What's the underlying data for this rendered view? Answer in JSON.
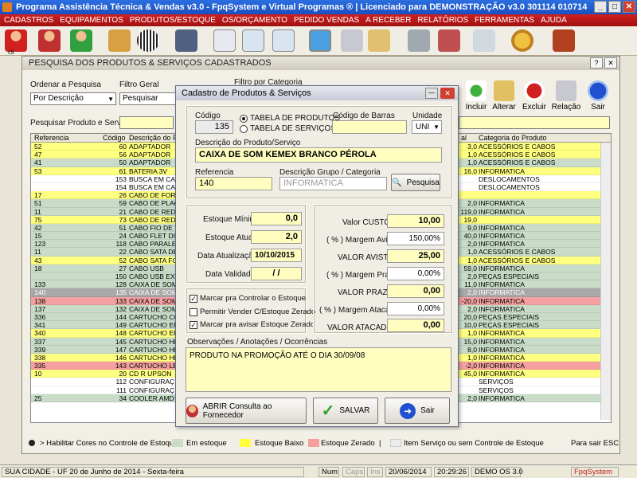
{
  "app": {
    "title": "Programa Assistência Técnica & Vendas v3.0 - FpqSystem e Virtual Programas ® | Licenciado para  DEMONSTRAÇÃO v3.0 301114 010714"
  },
  "menu": [
    "CADASTROS",
    "EQUIPAMENTOS",
    "PRODUTOS/ESTOQUE",
    "OS/ORÇAMENTO",
    "PEDIDO VENDAS",
    "A RECEBER",
    "RELATÓRIOS",
    "FERRAMENTAS",
    "AJUDA"
  ],
  "toolbar": {
    "first_label": "cli"
  },
  "main": {
    "title": "PESQUISA DOS PRODUTOS & SERVIÇOS CADASTRADOS",
    "order_label": "Ordenar a Pesquisa",
    "order_value": "Por Descrição",
    "filter_label": "Filtro Geral",
    "filter_value": "Pesquisar TODOS",
    "category_label": "Filtro por Categoria",
    "search_label": "Pesquisar Produto e Serviço",
    "buttons": {
      "incluir": "Incluir",
      "alterar": "Alterar",
      "excluir": "Excluir",
      "relacao": "Relação",
      "sair": "Sair"
    },
    "columns": [
      "Referencia",
      "Código",
      "Descrição do Pr",
      "al",
      "Categoria do Produto"
    ],
    "rows": [
      {
        "ref": "52",
        "cod": "60",
        "desc": "ADAPTADOR",
        "qty": "3,0",
        "cat": "ACESSÓRIOS E CABOS",
        "c": "y"
      },
      {
        "ref": "47",
        "cod": "56",
        "desc": "ADAPTADOR",
        "qty": "1,0",
        "cat": "ACESSÓRIOS E CABOS",
        "c": "y"
      },
      {
        "ref": "41",
        "cod": "50",
        "desc": "ADAPTADOR",
        "qty": "1,0",
        "cat": "ACESSÓRIOS E CABOS",
        "c": "g"
      },
      {
        "ref": "53",
        "cod": "61",
        "desc": "BATERIA 3V",
        "qty": "16,0",
        "cat": "INFORMATICA",
        "c": "y"
      },
      {
        "ref": "",
        "cod": "153",
        "desc": "BUSCA EM CAS",
        "qty": "",
        "cat": "DESLOCAMENTOS",
        "c": "w"
      },
      {
        "ref": "",
        "cod": "154",
        "desc": "BUSCA EM CAS",
        "qty": "",
        "cat": "DESLOCAMENTOS",
        "c": "w"
      },
      {
        "ref": "17",
        "cod": "26",
        "desc": "CABO DE FOR",
        "qty": "",
        "cat": "",
        "c": "y"
      },
      {
        "ref": "51",
        "cod": "59",
        "desc": "CABO DE PLAC",
        "qty": "2,0",
        "cat": "INFORMATICA",
        "c": "g"
      },
      {
        "ref": "11",
        "cod": "21",
        "desc": "CABO DE RED",
        "qty": "119,0",
        "cat": "INFORMATICA",
        "c": "g"
      },
      {
        "ref": "75",
        "cod": "73",
        "desc": "CABO DE RED",
        "qty": "19,0",
        "cat": "",
        "c": "y"
      },
      {
        "ref": "42",
        "cod": "51",
        "desc": "CABO FIO DE T",
        "qty": "9,0",
        "cat": "INFORMATICA",
        "c": "g"
      },
      {
        "ref": "15",
        "cod": "24",
        "desc": "CABO FLET DIS",
        "qty": "40,0",
        "cat": "INFORMATICA",
        "c": "g"
      },
      {
        "ref": "123",
        "cod": "118",
        "desc": "CABO PARALE",
        "qty": "2,0",
        "cat": "INFORMATICA",
        "c": "g"
      },
      {
        "ref": "11",
        "cod": "22",
        "desc": "CABO SATA DE",
        "qty": "1,0",
        "cat": "ACESSÓRIOS E CABOS",
        "c": "g"
      },
      {
        "ref": "43",
        "cod": "52",
        "desc": "CABO SATA FO",
        "qty": "1,0",
        "cat": "ACESSÓRIOS E CABOS",
        "c": "y"
      },
      {
        "ref": "18",
        "cod": "27",
        "desc": "CABO USB",
        "qty": "59,0",
        "cat": "INFORMATICA",
        "c": "g"
      },
      {
        "ref": "",
        "cod": "150",
        "desc": "CABO USB EXT",
        "qty": "2,0",
        "cat": "PEÇAS ESPECIAIS",
        "c": "g"
      },
      {
        "ref": "133",
        "cod": "128",
        "desc": "CAIXA DE SOM",
        "qty": "11,0",
        "cat": "INFORMATICA",
        "c": "g"
      },
      {
        "ref": "140",
        "cod": "135",
        "desc": "CAIXA DE SOM",
        "qty": "2,0",
        "cat": "INFORMATICA",
        "c": "sel"
      },
      {
        "ref": "138",
        "cod": "133",
        "desc": "CAIXA DE SOM",
        "qty": "-20,0",
        "cat": "INFORMATICA",
        "c": "r"
      },
      {
        "ref": "137",
        "cod": "132",
        "desc": "CAIXA DE SOM",
        "qty": "2,0",
        "cat": "INFORMATICA",
        "c": "g"
      },
      {
        "ref": "336",
        "cod": "144",
        "desc": "CARTUCHO CC",
        "qty": "20,0",
        "cat": "PEÇAS ESPECIAIS",
        "c": "g"
      },
      {
        "ref": "341",
        "cod": "149",
        "desc": "CARTUCHO EP",
        "qty": "10,0",
        "cat": "PEÇAS ESPECIAIS",
        "c": "g"
      },
      {
        "ref": "340",
        "cod": "148",
        "desc": "CARTUCHO EP",
        "qty": "1,0",
        "cat": "INFORMATICA",
        "c": "y"
      },
      {
        "ref": "337",
        "cod": "145",
        "desc": "CARTUCHO HP",
        "qty": "15,0",
        "cat": "INFORMATICA",
        "c": "g"
      },
      {
        "ref": "339",
        "cod": "147",
        "desc": "CARTUCHO HP",
        "qty": "8,0",
        "cat": "INFORMATICA",
        "c": "g"
      },
      {
        "ref": "338",
        "cod": "146",
        "desc": "CARTUCHO HP",
        "qty": "1,0",
        "cat": "INFORMATICA",
        "c": "y"
      },
      {
        "ref": "335",
        "cod": "143",
        "desc": "CARTUCHO LE",
        "qty": "-2,0",
        "cat": "INFORMATICA",
        "c": "r"
      },
      {
        "ref": "10",
        "cod": "20",
        "desc": "CD R UPSON",
        "qty": "45,0",
        "cat": "INFORMATICA",
        "c": "y"
      },
      {
        "ref": "",
        "cod": "112",
        "desc": "CONFIGURAÇ",
        "qty": "",
        "cat": "SERVIÇOS",
        "c": "w"
      },
      {
        "ref": "",
        "cod": "111",
        "desc": "CONFIGURAÇ",
        "qty": "",
        "cat": "SERVIÇOS",
        "c": "w"
      },
      {
        "ref": "25",
        "cod": "34",
        "desc": "COOLER AMD",
        "qty": "2,0",
        "cat": "INFORMATICA",
        "c": "g"
      }
    ]
  },
  "colors": {
    "y": "#ffff80",
    "g": "#c8dcc8",
    "w": "#ffffff",
    "r": "#f4a0a0",
    "sel": "#a8a8a8"
  },
  "legend": {
    "enable": "> Habilitar Cores no Controle de Estoque",
    "stock": "Em estoque",
    "low": "Estoque Baixo",
    "zero": "Estoque Zerado",
    "sep": "|",
    "service": "Item Serviço ou sem Controle de Estoque",
    "esc": "Para sair ESC"
  },
  "modal": {
    "title": "Cadastro de Produtos & Serviços",
    "codigo_label": "Código",
    "codigo": "135",
    "radio_products": "TABELA DE PRODUTOS",
    "radio_services": "TABELA DE SERVIÇOS",
    "barcode_label": "Código de Barras",
    "barcode": "",
    "unit_label": "Unidade",
    "unit": "UNI",
    "desc_label": "Descrição do Produto/Serviço",
    "desc": "CAIXA DE SOM  KEMEX  BRANCO  PÉROLA",
    "ref_label": "Referencia",
    "ref": "140",
    "group_label": "Descrição Grupo / Categoria",
    "group": "INFORMATICA",
    "search_btn": "Pesquisa",
    "est_min_label": "Estoque Mínimo",
    "est_min": "0,0",
    "est_atual_label": "Estoque Atual",
    "est_atual": "2,0",
    "data_atual_label": "Data Atualização",
    "data_atual": "10/10/2015",
    "data_val_label": "Data Validade",
    "data_val": " /  /",
    "chk1": "Marcar pra Controlar o Estoque",
    "chk2": "Permitir Vender C/Estoque Zerado",
    "chk3": "Marcar pra avisar Estoque Zerado",
    "custo_label": "Valor CUSTO",
    "custo": "10,00",
    "mav_label": "( % ) Margem Avista",
    "mav": "150,00%",
    "vav_label": "VALOR AVISTA",
    "vav": "25,00",
    "mpr_label": "( % ) Margem Prazo",
    "mpr": "0,00%",
    "vpr_label": "VALOR PRAZO",
    "vpr": "0,00",
    "mat_label": "( % ) Margem Atacado",
    "mat": "0,00%",
    "vat_label": "VALOR ATACADO",
    "vat": "0,00",
    "obs_label": "Observações / Anotações / Ocorrências",
    "obs": "PRODUTO NA PROMOÇÃO ATÉ O DIA 30/09/08",
    "btn_consulta": "ABRIR Consulta ao Fornecedor",
    "btn_salvar": "SALVAR",
    "btn_sair": "Sair"
  },
  "status": {
    "city": "SUA CIDADE - UF 20 de Junho de 2014 - Sexta-feira",
    "num": "Num",
    "caps": "Caps",
    "ins": "Ins",
    "date": "20/06/2014",
    "time": "20:29:26",
    "demo": "DEMO OS 3.0",
    "brand": "FpqSystem"
  }
}
